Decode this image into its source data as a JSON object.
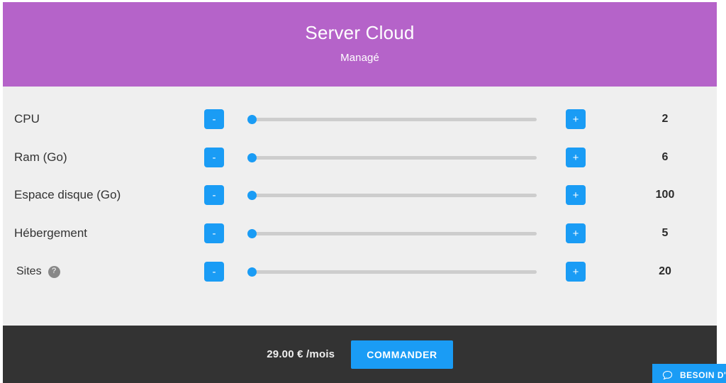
{
  "header": {
    "title": "Server Cloud",
    "subtitle": "Managé",
    "background_color": "#b563c9"
  },
  "accent_color": "#1a9cf5",
  "panel": {
    "background_color": "#efefef",
    "rows": [
      {
        "label": "CPU",
        "decrement_label": "-",
        "increment_label": "+",
        "value": "2",
        "slider_position_percent": 0,
        "has_help": false
      },
      {
        "label": "Ram (Go)",
        "decrement_label": "-",
        "increment_label": "+",
        "value": "6",
        "slider_position_percent": 0,
        "has_help": false
      },
      {
        "label": "Espace disque (Go)",
        "decrement_label": "-",
        "increment_label": "+",
        "value": "100",
        "slider_position_percent": 0,
        "has_help": false
      },
      {
        "label": "Hébergement",
        "decrement_label": "-",
        "increment_label": "+",
        "value": "5",
        "slider_position_percent": 0,
        "has_help": false
      },
      {
        "label": "Sites",
        "decrement_label": "-",
        "increment_label": "+",
        "value": "20",
        "slider_position_percent": 0,
        "has_help": true,
        "help_icon": "question-mark-icon",
        "help_label": "?"
      }
    ]
  },
  "footer": {
    "price": "29.00 € /mois",
    "order_button_label": "COMMANDER",
    "background_color": "#333333"
  },
  "chat_widget": {
    "icon": "speech-bubble-icon",
    "label": "BESOIN D'AIDE ?",
    "background_color": "#1a9cf5"
  }
}
